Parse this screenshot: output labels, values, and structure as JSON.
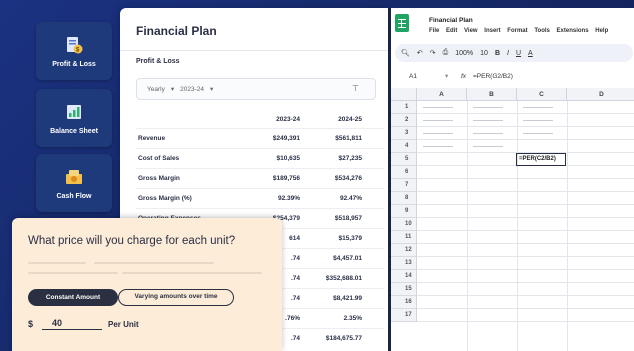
{
  "nav": {
    "items": [
      {
        "label": "Profit & Loss",
        "icon": "profit-loss-icon"
      },
      {
        "label": "Balance Sheet",
        "icon": "balance-sheet-icon"
      },
      {
        "label": "Cash Flow",
        "icon": "cash-flow-icon"
      }
    ]
  },
  "plan": {
    "title": "Financial Plan",
    "subtitle": "Profit & Loss",
    "filter": {
      "period": "Yearly",
      "year": "2023-24"
    },
    "columns": [
      "2023-24",
      "2024-25"
    ],
    "rows": [
      {
        "label": "Revenue",
        "v1": "$249,391",
        "v2": "$561,811"
      },
      {
        "label": "Cost of Sales",
        "v1": "$10,635",
        "v2": "$27,235"
      },
      {
        "label": "Gross Margin",
        "v1": "$189,756",
        "v2": "$534,276"
      },
      {
        "label": "Gross Margin (%)",
        "v1": "92.39%",
        "v2": "92.47%"
      },
      {
        "label": "Operating Expenses",
        "v1": "$254,379",
        "v2": "$518,957"
      },
      {
        "label": "",
        "v1": "614",
        "v2": "$15,379"
      },
      {
        "label": "",
        "v1": ".74",
        "v2": "$4,457.01"
      },
      {
        "label": "",
        "v1": ".74",
        "v2": "$352,688.01"
      },
      {
        "label": "",
        "v1": ".74",
        "v2": "$8,421.99"
      },
      {
        "label": "",
        "v1": ".76%",
        "v2": "2.35%"
      },
      {
        "label": "",
        "v1": ".74",
        "v2": "$184,675.77"
      }
    ]
  },
  "sheet": {
    "title": "Financial Plan",
    "menu": [
      "File",
      "Edit",
      "View",
      "Insert",
      "Format",
      "Tools",
      "Extensions",
      "Help"
    ],
    "toolbar": {
      "zoom": "100%",
      "font_size": "10",
      "bold": "B",
      "italic": "I",
      "underline": "U",
      "text_color": "A"
    },
    "cell_ref": "A1",
    "fx": "fx",
    "formula": "=PER(G2/B2)",
    "columns": [
      "A",
      "B",
      "C",
      "D"
    ],
    "row_numbers": [
      "1",
      "2",
      "3",
      "4",
      "5",
      "6",
      "7",
      "8",
      "9",
      "10",
      "11",
      "12",
      "13",
      "14",
      "15",
      "16",
      "17"
    ],
    "active_cell_value": "=PER(C2/B2)"
  },
  "price": {
    "question": "What price will you charge for each unit?",
    "constant_label": "Constant Amount",
    "varying_label": "Varying amounts over time",
    "currency": "$",
    "amount": "40",
    "unit_label": "Per Unit"
  },
  "colors": {
    "background": "#16296a",
    "tile": "#1e3a7a",
    "card": "#fdecd8",
    "dark_button": "#2a3042",
    "sheets_green": "#1fa463"
  }
}
